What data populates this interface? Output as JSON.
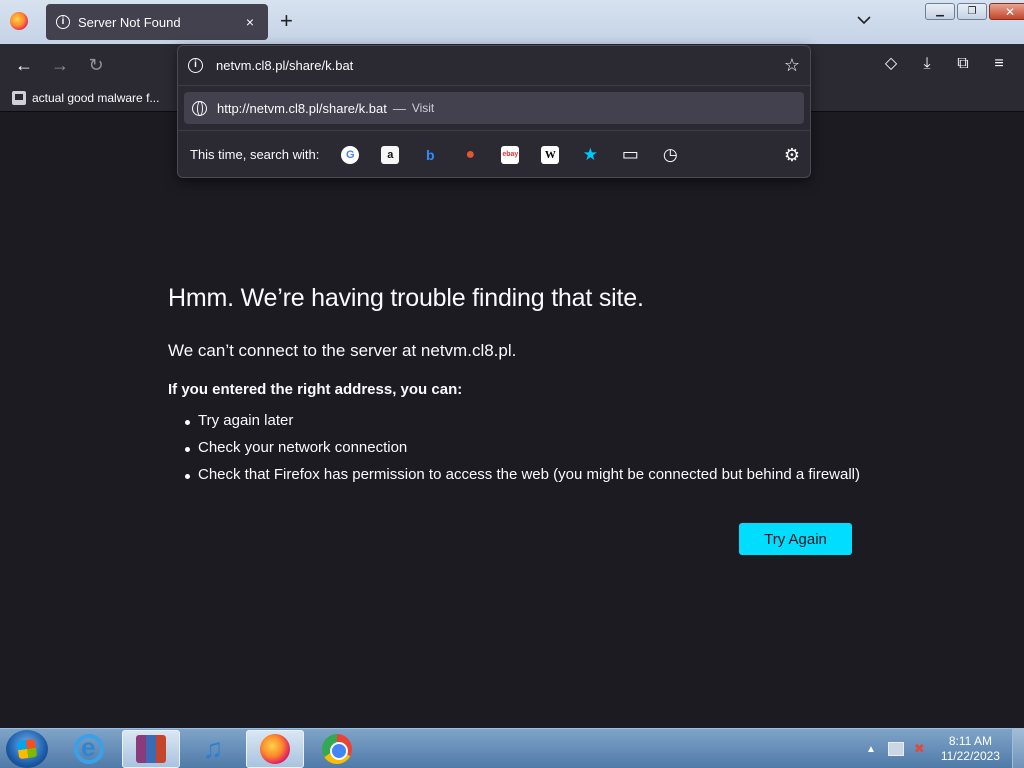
{
  "browser": {
    "tab": {
      "title": "Server Not Found",
      "close_icon": "×"
    },
    "new_tab_icon": "+",
    "window_buttons": {
      "minimize": "▁",
      "restore": "❐",
      "close": "✕"
    }
  },
  "nav": {
    "back": "←",
    "forward": "→",
    "reload": "↻"
  },
  "toolbar_right": {
    "pocket": "◇",
    "downloads": "⤓",
    "extensions": "⧉",
    "menu": "≡"
  },
  "bookmarks": [
    {
      "label": "actual good malware f..."
    }
  ],
  "url_popup": {
    "url_value": "netvm.cl8.pl/share/k.bat",
    "suggestion": {
      "url": "http://netvm.cl8.pl/share/k.bat",
      "dash": "—",
      "action": "Visit"
    },
    "search_label": "This time, search with:",
    "engines": [
      {
        "name": "google-icon",
        "glyph": "G",
        "bg": "#ffffff",
        "fg": "#4285f4"
      },
      {
        "name": "amazon-icon",
        "glyph": "a",
        "bg": "#f7f7f7",
        "fg": "#111111"
      },
      {
        "name": "bing-icon",
        "glyph": "b",
        "bg": "transparent",
        "fg": "#2f8cff"
      },
      {
        "name": "duckduckgo-icon",
        "glyph": "●",
        "bg": "transparent",
        "fg": "#de5833"
      },
      {
        "name": "ebay-icon",
        "glyph": "ebay",
        "bg": "#ffffff",
        "fg": "#e53238"
      },
      {
        "name": "wikipedia-icon",
        "glyph": "W",
        "bg": "#ffffff",
        "fg": "#000000"
      },
      {
        "name": "bookmarks-star-icon",
        "glyph": "★",
        "bg": "transparent",
        "fg": "#00c8ff"
      },
      {
        "name": "tabs-icon",
        "glyph": "▭",
        "bg": "transparent",
        "fg": "#fbfbfe"
      },
      {
        "name": "history-icon",
        "glyph": "◷",
        "bg": "transparent",
        "fg": "#fbfbfe"
      }
    ],
    "settings_icon": "⚙"
  },
  "error_page": {
    "title": "Hmm. We’re having trouble finding that site.",
    "message": "We can’t connect to the server at netvm.cl8.pl.",
    "subheading": "If you entered the right address, you can:",
    "suggestions": [
      "Try again later",
      "Check your network connection",
      "Check that Firefox has permission to access the web (you might be connected but behind a firewall)"
    ],
    "button_label": "Try Again"
  },
  "taskbar": {
    "time": "8:11 AM",
    "date": "11/22/2023",
    "tray_up": "▲",
    "tray_flag": "✖"
  },
  "colors": {
    "page_bg": "#1c1b22",
    "accent_button": "#00ddff",
    "toolbar": "#2b2a33"
  }
}
